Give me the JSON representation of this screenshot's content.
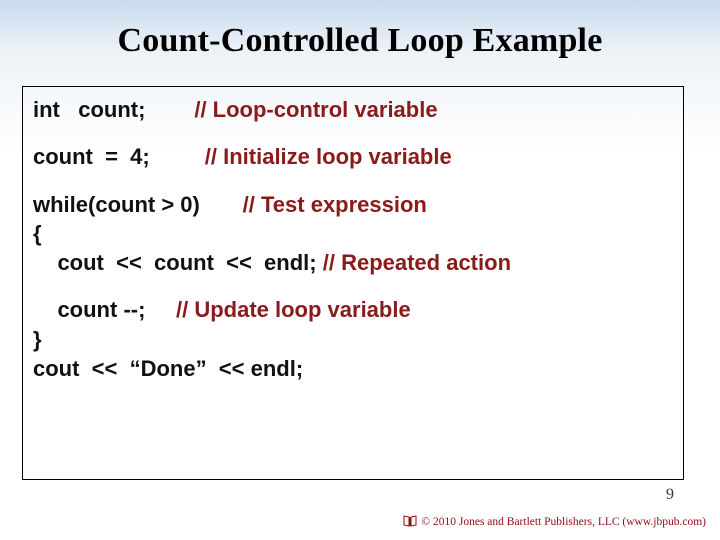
{
  "title": "Count-Controlled Loop Example",
  "code": {
    "l1a": "int   count;",
    "l1b": "// Loop-control variable",
    "l2a": "count  =  4;",
    "l2b": "// Initialize loop variable",
    "l3a": "while(count > 0)",
    "l3b": "// Test expression",
    "l4": "{",
    "l5a": "    cout  <<  count  <<  endl;",
    "l5b": "// Repeated action",
    "l6a": "    count --;",
    "l6b": "// Update loop variable",
    "l7": "}",
    "l8": "cout  <<  “Done”  << endl;"
  },
  "page_number": "9",
  "copyright": "© 2010 Jones and Bartlett Publishers, LLC (www.jbpub.com)"
}
